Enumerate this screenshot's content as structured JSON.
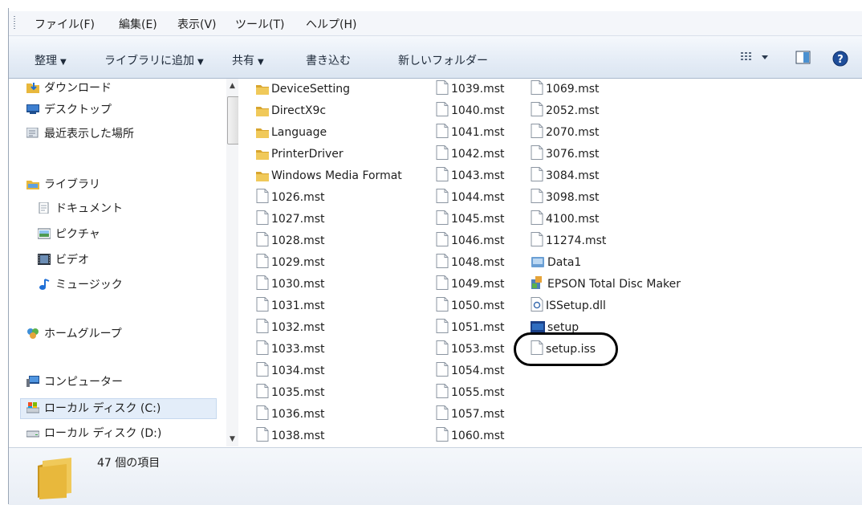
{
  "menubar": {
    "items": [
      "ファイル(F)",
      "編集(E)",
      "表示(V)",
      "ツール(T)",
      "ヘルプ(H)"
    ]
  },
  "toolbar": {
    "organize": "整理",
    "add_to_library": "ライブラリに追加",
    "share": "共有",
    "burn": "書き込む",
    "new_folder": "新しいフォルダー"
  },
  "nav": {
    "items": [
      {
        "label": "ダウンロード",
        "icon": "downloads-folder-icon"
      },
      {
        "label": "デスクトップ",
        "icon": "desktop-icon"
      },
      {
        "label": "最近表示した場所",
        "icon": "recent-places-icon"
      },
      {
        "label": "ライブラリ",
        "icon": "library-icon"
      },
      {
        "label": "ドキュメント",
        "icon": "documents-icon"
      },
      {
        "label": "ピクチャ",
        "icon": "pictures-icon"
      },
      {
        "label": "ビデオ",
        "icon": "videos-icon"
      },
      {
        "label": "ミュージック",
        "icon": "music-icon"
      },
      {
        "label": "ホームグループ",
        "icon": "homegroup-icon"
      },
      {
        "label": "コンピューター",
        "icon": "computer-icon"
      },
      {
        "label": "ローカル ディスク (C:)",
        "icon": "system-drive-icon"
      },
      {
        "label": "ローカル ディスク (D:)",
        "icon": "drive-icon"
      }
    ]
  },
  "files": {
    "col1": [
      {
        "name": "DeviceSetting",
        "type": "folder"
      },
      {
        "name": "DirectX9c",
        "type": "folder"
      },
      {
        "name": "Language",
        "type": "folder"
      },
      {
        "name": "PrinterDriver",
        "type": "folder"
      },
      {
        "name": "Windows Media Format",
        "type": "folder"
      },
      {
        "name": "1026.mst",
        "type": "file"
      },
      {
        "name": "1027.mst",
        "type": "file"
      },
      {
        "name": "1028.mst",
        "type": "file"
      },
      {
        "name": "1029.mst",
        "type": "file"
      },
      {
        "name": "1030.mst",
        "type": "file"
      },
      {
        "name": "1031.mst",
        "type": "file"
      },
      {
        "name": "1032.mst",
        "type": "file"
      },
      {
        "name": "1033.mst",
        "type": "file"
      },
      {
        "name": "1034.mst",
        "type": "file"
      },
      {
        "name": "1035.mst",
        "type": "file"
      },
      {
        "name": "1036.mst",
        "type": "file"
      },
      {
        "name": "1038.mst",
        "type": "file"
      }
    ],
    "col2": [
      {
        "name": "1039.mst",
        "type": "file"
      },
      {
        "name": "1040.mst",
        "type": "file"
      },
      {
        "name": "1041.mst",
        "type": "file"
      },
      {
        "name": "1042.mst",
        "type": "file"
      },
      {
        "name": "1043.mst",
        "type": "file"
      },
      {
        "name": "1044.mst",
        "type": "file"
      },
      {
        "name": "1045.mst",
        "type": "file"
      },
      {
        "name": "1046.mst",
        "type": "file"
      },
      {
        "name": "1048.mst",
        "type": "file"
      },
      {
        "name": "1049.mst",
        "type": "file"
      },
      {
        "name": "1050.mst",
        "type": "file"
      },
      {
        "name": "1051.mst",
        "type": "file"
      },
      {
        "name": "1053.mst",
        "type": "file"
      },
      {
        "name": "1054.mst",
        "type": "file"
      },
      {
        "name": "1055.mst",
        "type": "file"
      },
      {
        "name": "1057.mst",
        "type": "file"
      },
      {
        "name": "1060.mst",
        "type": "file"
      }
    ],
    "col3": [
      {
        "name": "1069.mst",
        "type": "file"
      },
      {
        "name": "2052.mst",
        "type": "file"
      },
      {
        "name": "2070.mst",
        "type": "file"
      },
      {
        "name": "3076.mst",
        "type": "file"
      },
      {
        "name": "3084.mst",
        "type": "file"
      },
      {
        "name": "3098.mst",
        "type": "file"
      },
      {
        "name": "4100.mst",
        "type": "file"
      },
      {
        "name": "11274.mst",
        "type": "file"
      },
      {
        "name": "Data1",
        "type": "cab"
      },
      {
        "name": "EPSON Total Disc Maker",
        "type": "installer"
      },
      {
        "name": "ISSetup.dll",
        "type": "dll"
      },
      {
        "name": "setup",
        "type": "exe"
      },
      {
        "name": "setup.iss",
        "type": "file"
      }
    ]
  },
  "status": {
    "count_text": "47 個の項目"
  },
  "colors": {
    "folder": "#e8b83c",
    "selection": "#e3edf9",
    "toolbar_top": "#f5f8fc",
    "toolbar_bottom": "#dbe5f1"
  }
}
